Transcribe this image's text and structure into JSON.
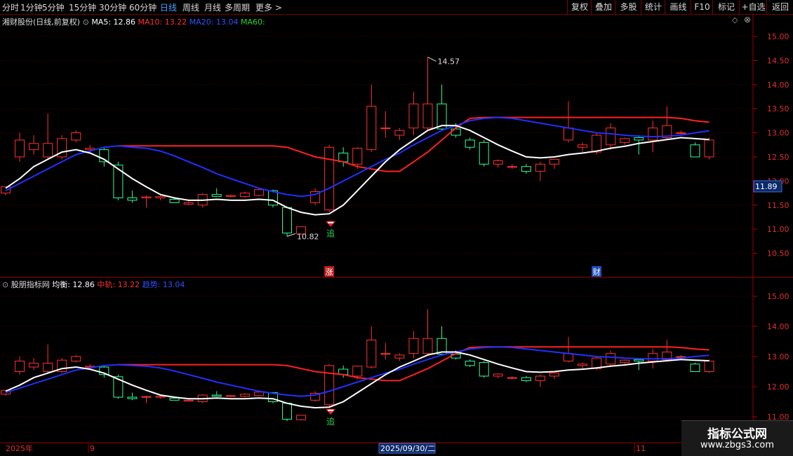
{
  "toolbar": {
    "periods": [
      "分时",
      "1分钟",
      "5分钟",
      "15分钟",
      "30分钟",
      "60分钟",
      "日线",
      "周线",
      "月线",
      "多周期",
      "更多"
    ],
    "active_period": "日线",
    "right_buttons": [
      "复权",
      "叠加",
      "多股",
      "统计",
      "画线",
      "F10",
      "标记",
      "+自选",
      "返回"
    ]
  },
  "main_panel": {
    "stock_name": "湘财股份",
    "mode": "(日线,前复权)",
    "legend": [
      {
        "label": "MA5: 12.86",
        "color": "#ffffff"
      },
      {
        "label": "MA10: 13.22",
        "color": "#ff3030"
      },
      {
        "label": "MA20: 13.04",
        "color": "#3030ff"
      },
      {
        "label": "MA60:",
        "color": "#30d030"
      }
    ],
    "y_ticks": [
      "15.00",
      "14.50",
      "14.00",
      "13.50",
      "13.00",
      "12.50",
      "12.00",
      "11.50",
      "11.00",
      "10.50"
    ],
    "current_price": "11.89",
    "high_label": "14.57",
    "low_label": "10.82",
    "signal_text": "追",
    "event_markers": [
      "涨",
      "财"
    ]
  },
  "sub_panel": {
    "title": "股朋指标网",
    "legend": [
      {
        "label": "均衡: 12.86",
        "color": "#ffffff"
      },
      {
        "label": "中轨: 13.22",
        "color": "#ff3030"
      },
      {
        "label": "趋势: 13.04",
        "color": "#3030ff"
      }
    ],
    "y_ticks": [
      "15.00",
      "14.00",
      "13.00",
      "12.00",
      "11.00"
    ],
    "signal_text": "追"
  },
  "date_axis": {
    "labels": [
      "2025年",
      "9",
      "2025/09/30/二",
      "11"
    ]
  },
  "watermark": {
    "title": "指标公式网",
    "url": "www.zbgs3.com"
  },
  "chart_data": {
    "type": "candlestick",
    "candles": [
      {
        "o": 11.75,
        "h": 11.85,
        "l": 11.7,
        "c": 11.88
      },
      {
        "o": 12.5,
        "h": 13.0,
        "l": 12.4,
        "c": 12.85
      },
      {
        "o": 12.65,
        "h": 12.95,
        "l": 12.55,
        "c": 12.78
      },
      {
        "o": 12.5,
        "h": 13.4,
        "l": 12.45,
        "c": 12.78
      },
      {
        "o": 12.5,
        "h": 12.95,
        "l": 12.45,
        "c": 12.88
      },
      {
        "o": 12.85,
        "h": 13.05,
        "l": 12.8,
        "c": 13.0
      },
      {
        "o": 12.65,
        "h": 12.75,
        "l": 12.6,
        "c": 12.68
      },
      {
        "o": 12.65,
        "h": 12.7,
        "l": 12.3,
        "c": 12.4
      },
      {
        "o": 12.33,
        "h": 12.4,
        "l": 11.6,
        "c": 11.65
      },
      {
        "o": 11.65,
        "h": 11.8,
        "l": 11.55,
        "c": 11.6
      },
      {
        "o": 11.65,
        "h": 11.7,
        "l": 11.45,
        "c": 11.67
      },
      {
        "o": 11.65,
        "h": 11.7,
        "l": 11.6,
        "c": 11.68
      },
      {
        "o": 11.62,
        "h": 11.65,
        "l": 11.55,
        "c": 11.55
      },
      {
        "o": 11.52,
        "h": 11.58,
        "l": 11.5,
        "c": 11.55
      },
      {
        "o": 11.5,
        "h": 11.75,
        "l": 11.45,
        "c": 11.72
      },
      {
        "o": 11.72,
        "h": 11.85,
        "l": 11.68,
        "c": 11.68
      },
      {
        "o": 11.68,
        "h": 11.72,
        "l": 11.66,
        "c": 11.7
      },
      {
        "o": 11.68,
        "h": 11.78,
        "l": 11.65,
        "c": 11.75
      },
      {
        "o": 11.7,
        "h": 11.85,
        "l": 11.68,
        "c": 11.82
      },
      {
        "o": 11.8,
        "h": 11.82,
        "l": 11.45,
        "c": 11.5
      },
      {
        "o": 11.45,
        "h": 11.45,
        "l": 10.85,
        "c": 10.92
      },
      {
        "o": 10.9,
        "h": 11.05,
        "l": 10.88,
        "c": 11.05
      },
      {
        "o": 11.55,
        "h": 11.85,
        "l": 11.5,
        "c": 11.78
      },
      {
        "o": 11.4,
        "h": 12.75,
        "l": 11.35,
        "c": 12.7
      },
      {
        "o": 12.58,
        "h": 12.7,
        "l": 12.3,
        "c": 12.4
      },
      {
        "o": 12.35,
        "h": 12.7,
        "l": 12.25,
        "c": 12.68
      },
      {
        "o": 12.65,
        "h": 14.0,
        "l": 12.6,
        "c": 13.55
      },
      {
        "o": 13.1,
        "h": 13.45,
        "l": 12.9,
        "c": 13.1
      },
      {
        "o": 12.95,
        "h": 13.1,
        "l": 12.85,
        "c": 13.05
      },
      {
        "o": 13.1,
        "h": 13.85,
        "l": 12.95,
        "c": 13.6
      },
      {
        "o": 13.1,
        "h": 14.57,
        "l": 13.05,
        "c": 13.6
      },
      {
        "o": 13.6,
        "h": 14.0,
        "l": 13.05,
        "c": 13.08
      },
      {
        "o": 13.08,
        "h": 13.2,
        "l": 12.9,
        "c": 12.95
      },
      {
        "o": 12.85,
        "h": 12.9,
        "l": 12.65,
        "c": 12.7
      },
      {
        "o": 12.8,
        "h": 12.85,
        "l": 12.3,
        "c": 12.35
      },
      {
        "o": 12.35,
        "h": 12.45,
        "l": 12.28,
        "c": 12.42
      },
      {
        "o": 12.3,
        "h": 12.35,
        "l": 12.25,
        "c": 12.3
      },
      {
        "o": 12.3,
        "h": 12.35,
        "l": 12.15,
        "c": 12.2
      },
      {
        "o": 12.2,
        "h": 12.4,
        "l": 12.0,
        "c": 12.35
      },
      {
        "o": 12.35,
        "h": 12.45,
        "l": 12.25,
        "c": 12.45
      },
      {
        "o": 12.85,
        "h": 13.65,
        "l": 12.8,
        "c": 13.1
      },
      {
        "o": 12.7,
        "h": 12.8,
        "l": 12.6,
        "c": 12.75
      },
      {
        "o": 12.6,
        "h": 13.0,
        "l": 12.55,
        "c": 12.95
      },
      {
        "o": 12.75,
        "h": 13.2,
        "l": 12.65,
        "c": 13.1
      },
      {
        "o": 12.8,
        "h": 12.9,
        "l": 12.75,
        "c": 12.88
      },
      {
        "o": 12.9,
        "h": 12.95,
        "l": 12.55,
        "c": 12.85
      },
      {
        "o": 12.85,
        "h": 13.25,
        "l": 12.6,
        "c": 13.1
      },
      {
        "o": 12.9,
        "h": 13.55,
        "l": 12.85,
        "c": 13.15
      },
      {
        "o": 13.0,
        "h": 13.05,
        "l": 12.95,
        "c": 13.0
      },
      {
        "o": 12.75,
        "h": 12.8,
        "l": 12.6,
        "c": 12.5
      },
      {
        "o": 12.5,
        "h": 12.9,
        "l": 12.45,
        "c": 12.85
      }
    ],
    "ma5": [
      11.85,
      12.05,
      12.3,
      12.45,
      12.6,
      12.65,
      12.58,
      12.45,
      12.25,
      12.05,
      11.88,
      11.72,
      11.65,
      11.6,
      11.6,
      11.62,
      11.6,
      11.6,
      11.62,
      11.6,
      11.45,
      11.35,
      11.3,
      11.32,
      11.5,
      11.8,
      12.1,
      12.4,
      12.65,
      12.85,
      13.05,
      13.15,
      13.15,
      13.05,
      12.9,
      12.75,
      12.62,
      12.5,
      12.48,
      12.5,
      12.55,
      12.58,
      12.62,
      12.68,
      12.72,
      12.78,
      12.82,
      12.86,
      12.9,
      12.88,
      12.86
    ],
    "ma10": [
      null,
      null,
      null,
      null,
      null,
      null,
      null,
      null,
      12.73,
      12.73,
      12.73,
      12.73,
      12.73,
      12.73,
      12.73,
      12.73,
      12.73,
      12.73,
      12.73,
      12.73,
      12.7,
      12.6,
      12.5,
      12.45,
      12.4,
      12.3,
      12.25,
      12.2,
      12.2,
      12.4,
      12.6,
      12.85,
      13.1,
      13.3,
      13.32,
      13.32,
      13.32,
      13.32,
      13.32,
      13.32,
      13.32,
      13.32,
      13.32,
      13.32,
      13.32,
      13.32,
      13.32,
      13.32,
      13.3,
      13.25,
      13.22
    ],
    "ma20": [
      11.8,
      11.95,
      12.1,
      12.25,
      12.4,
      12.55,
      12.62,
      12.7,
      12.73,
      12.7,
      12.68,
      12.62,
      12.52,
      12.4,
      12.28,
      12.15,
      12.05,
      11.95,
      11.85,
      11.78,
      11.72,
      11.68,
      11.72,
      11.85,
      12.0,
      12.15,
      12.3,
      12.45,
      12.58,
      12.75,
      12.9,
      13.05,
      13.15,
      13.25,
      13.3,
      13.32,
      13.3,
      13.25,
      13.2,
      13.15,
      13.1,
      13.05,
      13.0,
      12.98,
      12.95,
      12.93,
      12.92,
      12.93,
      12.95,
      13.0,
      13.04
    ],
    "y_range": [
      10.4,
      15.2
    ]
  }
}
